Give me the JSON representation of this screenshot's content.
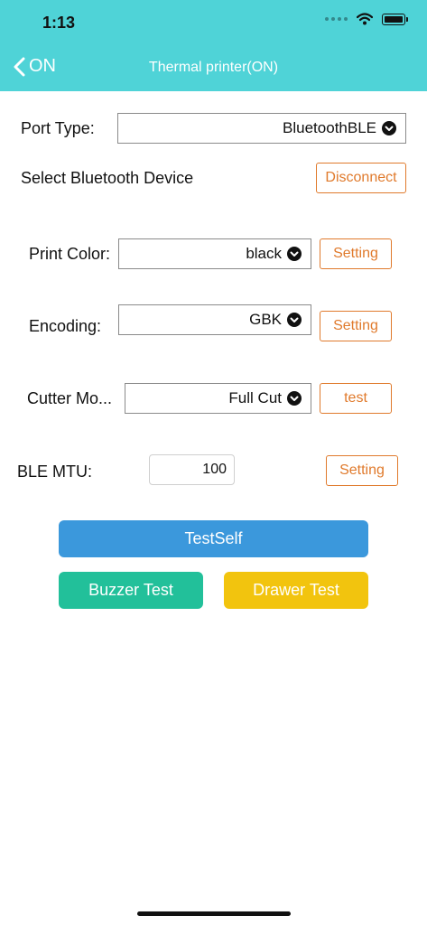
{
  "status_bar": {
    "time": "1:13"
  },
  "nav": {
    "back_label": "ON",
    "title": "Thermal  printer(ON)"
  },
  "port": {
    "label": "Port Type:",
    "value": "BluetoothBLE"
  },
  "bluetooth": {
    "label": "Select Bluetooth Device",
    "button": "Disconnect"
  },
  "print_color": {
    "label": "Print Color:",
    "value": "black",
    "button": "Setting"
  },
  "encoding": {
    "label": "Encoding:",
    "value": "GBK",
    "button": "Setting"
  },
  "cutter": {
    "label": "Cutter Mo...",
    "value": "Full Cut",
    "button": "test"
  },
  "mtu": {
    "label": "BLE MTU:",
    "value": "100",
    "button": "Setting"
  },
  "actions": {
    "testself": "TestSelf",
    "buzzer": "Buzzer Test",
    "drawer": "Drawer Test"
  },
  "colors": {
    "header": "#4fd3d7",
    "accent_orange": "#e07a2c",
    "testself_blue": "#3b98dc",
    "buzzer_green": "#22c09a",
    "drawer_yellow": "#f2c40e"
  }
}
